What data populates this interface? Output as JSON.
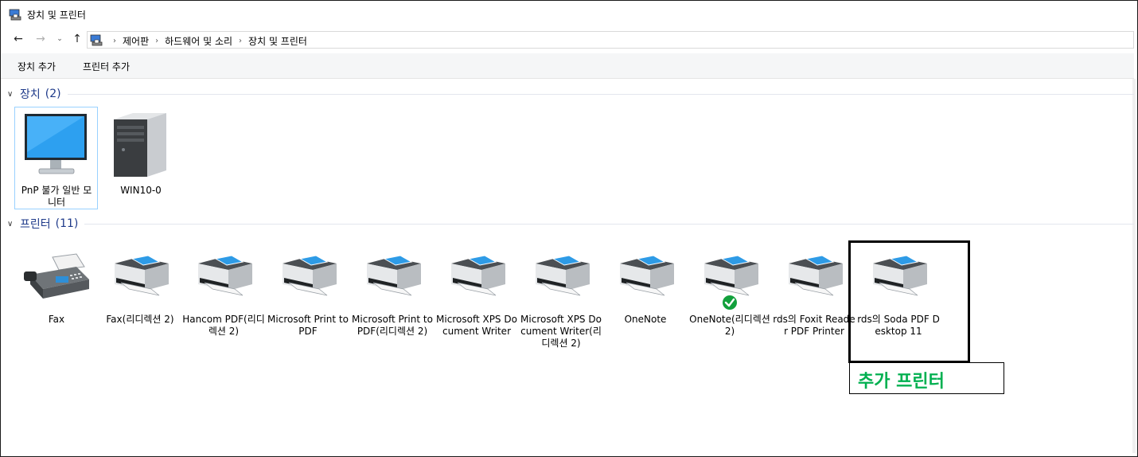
{
  "window": {
    "title": "장치 및 프린터"
  },
  "nav": {
    "breadcrumbs": [
      "제어판",
      "하드웨어 및 소리",
      "장치 및 프린터"
    ]
  },
  "commands": {
    "add_device": "장치 추가",
    "add_printer": "프린터 추가"
  },
  "groups": {
    "devices": {
      "title": "장치",
      "count": "(2)",
      "items": [
        {
          "label": "PnP 불가 일반 모니터",
          "icon": "monitor-icon"
        },
        {
          "label": "WIN10-0",
          "icon": "computer-tower-icon"
        }
      ]
    },
    "printers": {
      "title": "프린터",
      "count": "(11)",
      "items": [
        {
          "label": "Fax",
          "icon": "fax-icon"
        },
        {
          "label": "Fax(리디렉션 2)",
          "icon": "printer-icon"
        },
        {
          "label": "Hancom PDF(리디렉션 2)",
          "icon": "printer-icon"
        },
        {
          "label": "Microsoft Print to PDF",
          "icon": "printer-icon"
        },
        {
          "label": "Microsoft Print to PDF(리디렉션 2)",
          "icon": "printer-icon"
        },
        {
          "label": "Microsoft XPS Document Writer",
          "icon": "printer-icon"
        },
        {
          "label": "Microsoft XPS Document Writer(리디렉션 2)",
          "icon": "printer-icon"
        },
        {
          "label": "OneNote",
          "icon": "printer-icon"
        },
        {
          "label": "OneNote(리디렉션 2)",
          "icon": "printer-icon",
          "default": true
        },
        {
          "label": "rds의 Foxit Reader PDF Printer",
          "icon": "printer-icon"
        },
        {
          "label": "rds의 Soda PDF Desktop 11",
          "icon": "printer-icon"
        }
      ]
    }
  },
  "annotation": {
    "text": "추가 프린터",
    "color": "#00b050"
  },
  "colors": {
    "group_header": "#1e3a8a",
    "selection_border": "#99d1ff",
    "default_check": "#12a03c"
  }
}
